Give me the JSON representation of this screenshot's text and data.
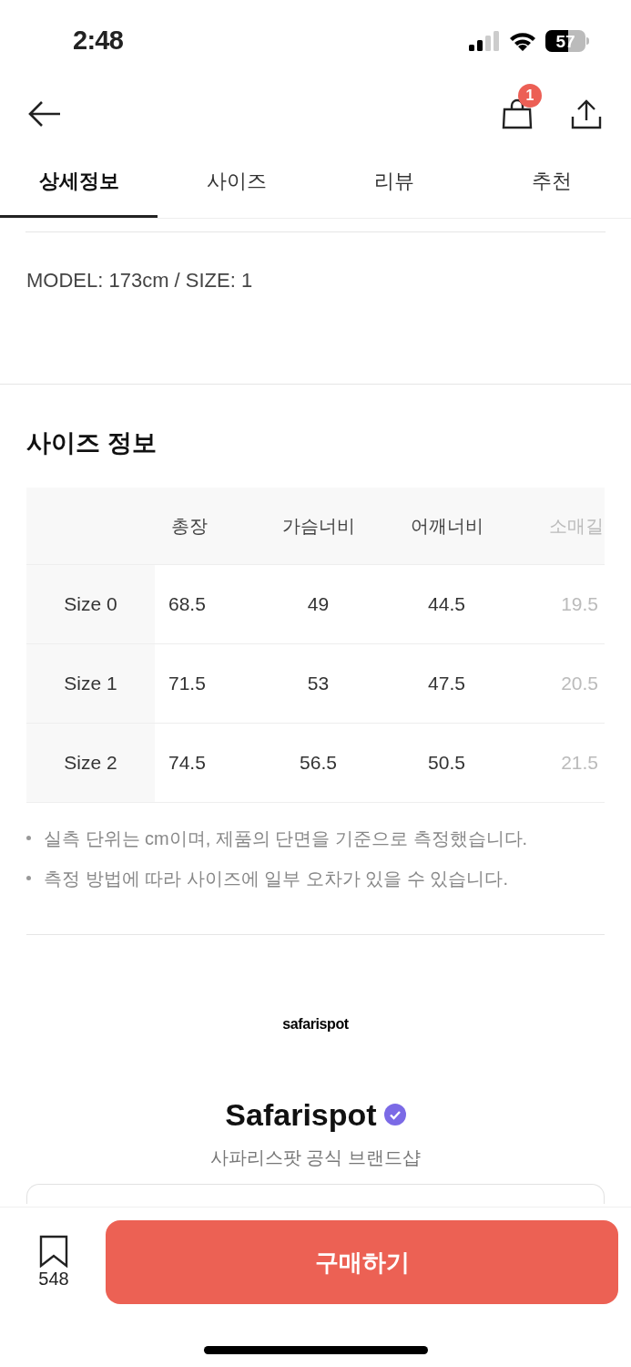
{
  "status_bar": {
    "time": "2:48",
    "battery": "57"
  },
  "header": {
    "cart_count": "1"
  },
  "tabs": [
    {
      "label": "상세정보",
      "selected": true
    },
    {
      "label": "사이즈",
      "selected": false
    },
    {
      "label": "리뷰",
      "selected": false
    },
    {
      "label": "추천",
      "selected": false
    }
  ],
  "model_info": "MODEL: 173cm / SIZE: 1",
  "size_info": {
    "title": "사이즈 정보",
    "table": {
      "columns": [
        "총장",
        "가슴너비",
        "어깨너비",
        "소매길"
      ],
      "rows": [
        {
          "label": "Size 0",
          "cells": [
            "68.5",
            "49",
            "44.5",
            "19.5"
          ]
        },
        {
          "label": "Size 1",
          "cells": [
            "71.5",
            "53",
            "47.5",
            "20.5"
          ]
        },
        {
          "label": "Size 2",
          "cells": [
            "74.5",
            "56.5",
            "50.5",
            "21.5"
          ]
        }
      ]
    },
    "notes": [
      "실측 단위는 cm이며, 제품의 단면을 기준으로 측정했습니다.",
      "측정 방법에 따라 사이즈에 일부 오차가 있을 수 있습니다."
    ]
  },
  "brand": {
    "logo": "safarispot",
    "name": "Safarispot",
    "verified": true,
    "subtitle": "사파리스팟 공식 브랜드샵"
  },
  "bottom_bar": {
    "bookmark_count": "548",
    "buy_label": "구매하기"
  }
}
